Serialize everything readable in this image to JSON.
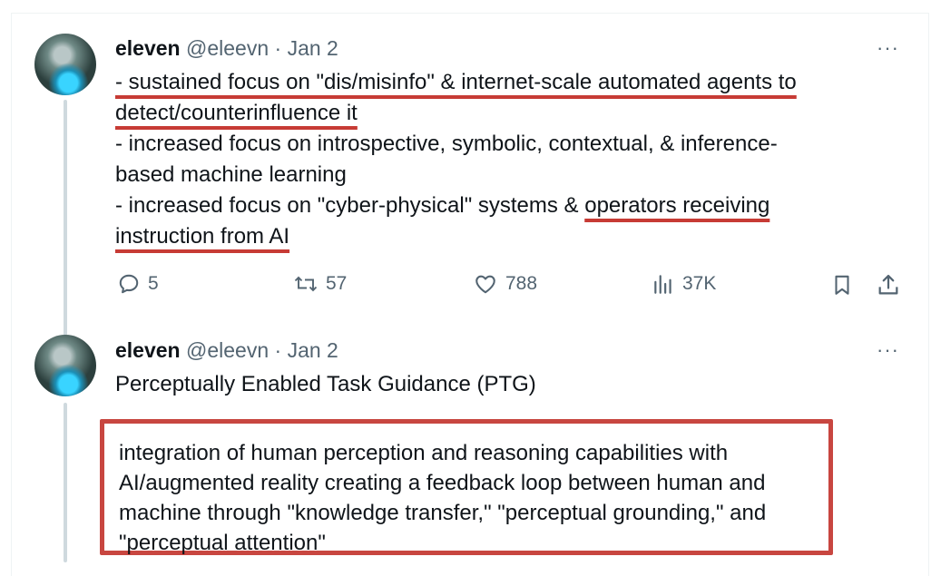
{
  "tweets": [
    {
      "name": "eleven",
      "handle": "@eleevn",
      "separator": "·",
      "date": "Jan 2",
      "more": "···",
      "lines": [
        "- sustained focus on \"dis/misinfo\" & internet-scale automated agents to",
        "detect/counterinfluence it",
        "- increased focus on introspective, symbolic, contextual, & inference-",
        "based machine learning",
        "- increased focus on \"cyber-physical\" systems & ",
        "operators receiving",
        "instruction from AI"
      ],
      "stats": {
        "replies": "5",
        "reposts": "57",
        "likes": "788",
        "views": "37K"
      }
    },
    {
      "name": "eleven",
      "handle": "@eleevn",
      "separator": "·",
      "date": "Jan 2",
      "more": "···",
      "title": "Perceptually Enabled Task Guidance (PTG)",
      "boxed_lines": [
        "integration of human perception and reasoning capabilities with",
        "AI/augmented reality creating a feedback loop between human and",
        "machine through \"knowledge transfer,\" \"perceptual grounding,\" and",
        "\"perceptual attention\""
      ]
    }
  ],
  "colors": {
    "annotation_red": "#c73b35",
    "muted_text": "#536471",
    "thread_line": "#cfd9de"
  },
  "icons": [
    "reply-icon",
    "repost-icon",
    "like-icon",
    "views-icon",
    "bookmark-icon",
    "share-icon",
    "more-icon"
  ]
}
